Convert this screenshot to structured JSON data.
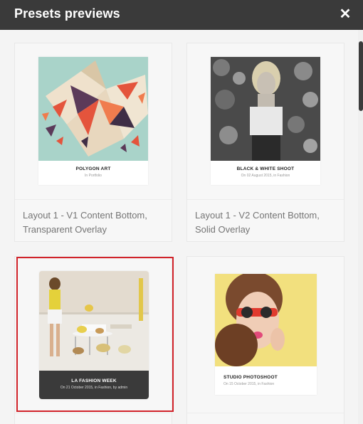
{
  "dialog": {
    "title": "Presets previews",
    "close_icon": "close-icon"
  },
  "presets": [
    {
      "label": "Layout 1 - V1 Content Bottom, Transparent Overlay",
      "preview_title": "POLYGON ART",
      "preview_meta": "In Portfolio"
    },
    {
      "label": "Layout 1 - V2 Content Bottom, Solid Overlay",
      "preview_title": "BLACK & WHITE SHOOT",
      "preview_meta": "On 02 August 2015, in Fashion"
    },
    {
      "label": "",
      "preview_title": "LA FASHION WEEK",
      "preview_meta": "On 21 October 2015, in Fashion, by admin",
      "selected": true
    },
    {
      "label": "",
      "preview_title": "STUDIO PHOTOSHOOT",
      "preview_meta": "On 15 October 2015, in Fashion"
    }
  ],
  "colors": {
    "header_bg": "#3a3a3a",
    "selected_border": "#d1232a"
  }
}
